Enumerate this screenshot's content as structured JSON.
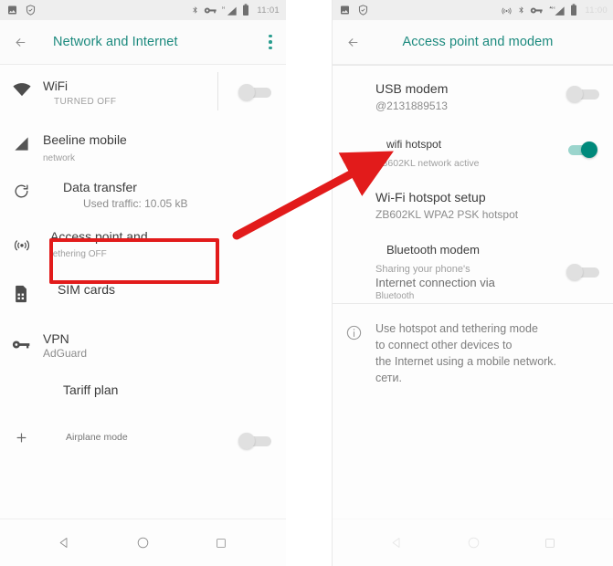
{
  "left_phone": {
    "statusbar": {
      "left_icons": [
        "image-icon",
        "shield-icon"
      ],
      "right_icons": [
        "bluetooth-icon",
        "vpn-key-icon",
        "signal-h-icon",
        "battery-icon"
      ],
      "time": "11:01"
    },
    "appbar": {
      "back_label": "back-arrow",
      "title": "Network and Internet",
      "overflow_label": "more-options"
    },
    "rows": [
      {
        "icon": "wifi-icon",
        "title": "WiFi",
        "sub": "TURNED OFF",
        "toggle": "off",
        "has_vertical_divider": true
      },
      {
        "icon": "signal-cellular-icon",
        "title": "Beeline mobile",
        "sub": "network",
        "toggle": "none"
      },
      {
        "icon": "data-transfer-icon",
        "title": "Data transfer",
        "sub": "Used traffic: 10.05 kB",
        "toggle": "none"
      },
      {
        "icon": "hotspot-icon",
        "title": "Access point and",
        "sub": "tethering OFF",
        "toggle": "none",
        "highlighted": true
      },
      {
        "icon": "sim-card-icon",
        "title": "SIM cards",
        "sub": "",
        "toggle": "none"
      },
      {
        "icon": "vpn-key-icon",
        "title": "VPN",
        "sub": "AdGuard",
        "toggle": "none"
      },
      {
        "icon": "",
        "title": "Tariff plan",
        "sub": "",
        "toggle": "none"
      },
      {
        "icon": "plus-icon",
        "title": "Airplane mode",
        "sub": "",
        "toggle": "off"
      }
    ],
    "navbar": [
      "back-triangle-icon",
      "home-circle-icon",
      "recents-square-icon"
    ]
  },
  "right_phone": {
    "statusbar": {
      "left_icons": [
        "image-icon",
        "shield-icon"
      ],
      "right_icons": [
        "hotspot-icon",
        "bluetooth-icon",
        "vpn-key-icon",
        "signal-h-icon",
        "battery-icon"
      ],
      "time": "11:00"
    },
    "appbar": {
      "back_label": "back-arrow",
      "title": "Access point and modem"
    },
    "rows": [
      {
        "title": "USB modem",
        "sub": "@2131889513",
        "toggle": "off"
      },
      {
        "title": "wifi hotspot",
        "sub": "ZB602KL network active",
        "toggle": "on"
      },
      {
        "title": "Wi-Fi hotspot setup",
        "sub": "ZB602KL WPA2 PSK hotspot",
        "toggle": "none"
      },
      {
        "title": "Bluetooth modem",
        "sub_lines": [
          "Sharing your phone's",
          "Internet connection via",
          "Bluetooth"
        ],
        "toggle": "off"
      }
    ],
    "info": {
      "icon": "info-icon",
      "lines": [
        "Use hotspot and tethering mode",
        "to connect other devices to",
        "the Internet using a mobile network.",
        "сети."
      ]
    },
    "navbar": [
      "back-triangle-icon",
      "home-circle-icon",
      "recents-square-icon"
    ]
  },
  "annotations": {
    "red_box_target": "Access point and",
    "arrow_from": "Access point and",
    "arrow_to": "wifi hotspot",
    "accent_color": "#e21b1b",
    "toggle_on_color": "#00897b",
    "title_color": "#1c8a7e"
  }
}
